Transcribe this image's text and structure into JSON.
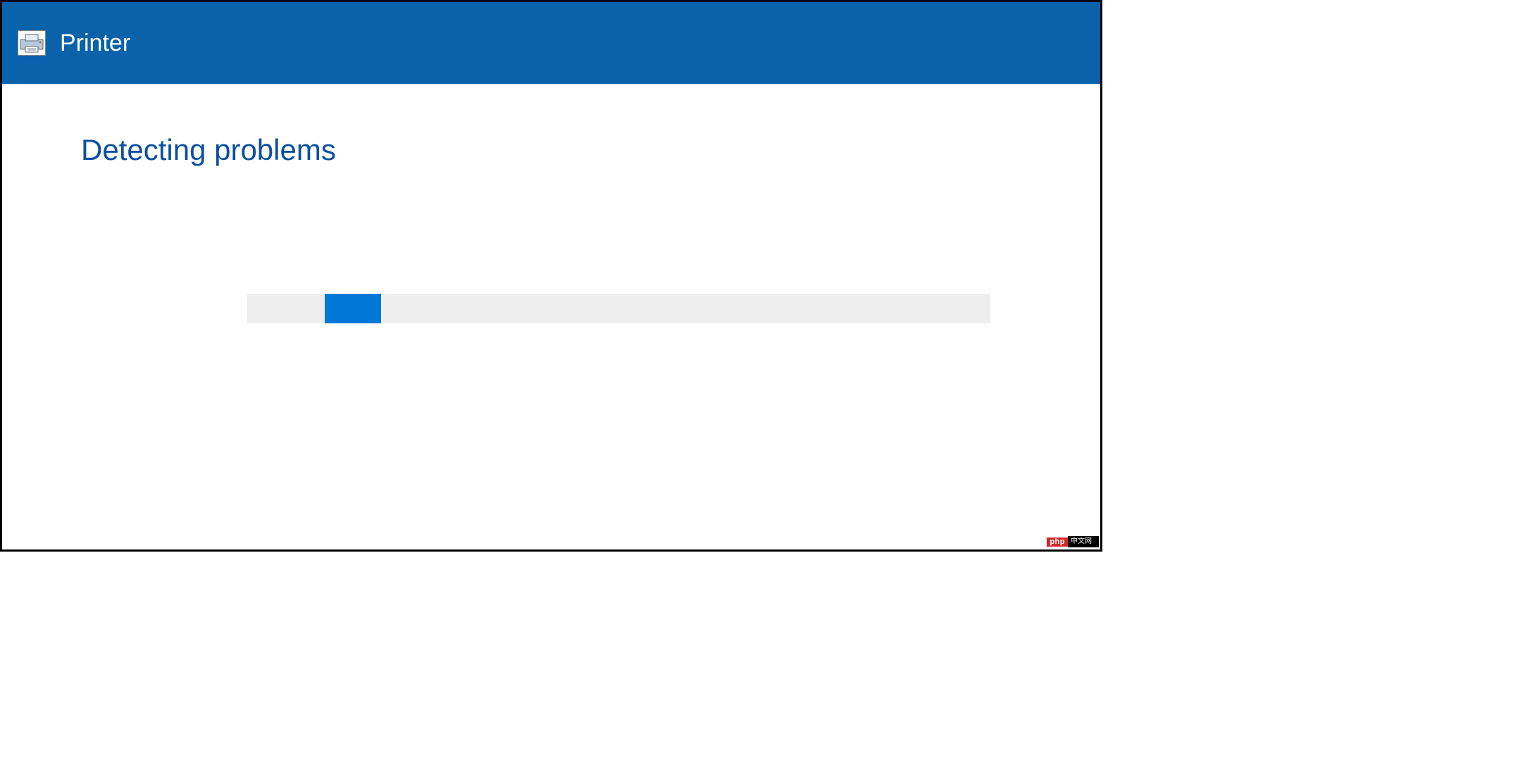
{
  "titlebar": {
    "icon_name": "printer-icon",
    "label": "Printer"
  },
  "content": {
    "heading": "Detecting problems"
  },
  "progress": {
    "track_color": "#eeeeee",
    "fill_color": "#0078d7"
  },
  "watermark": {
    "left": "php",
    "right": "中文网"
  }
}
